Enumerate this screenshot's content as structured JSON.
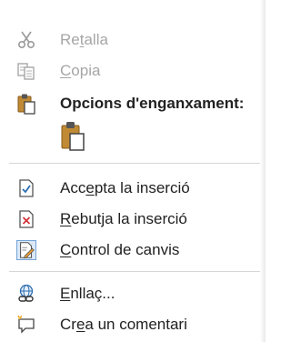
{
  "menu": {
    "cut": {
      "pre": "Re",
      "key": "t",
      "post": "alla",
      "icon": "scissors-icon",
      "enabled": false
    },
    "copy": {
      "pre": "",
      "key": "C",
      "post": "opia",
      "icon": "copy-icon",
      "enabled": false
    },
    "paste_options": {
      "label": "Opcions d'enganxament:",
      "icon": "clipboard-icon",
      "option_icon": "paste-keep-text-icon"
    },
    "accept": {
      "pre": "Acc",
      "key": "e",
      "post": "pta la inserció",
      "icon": "accept-change-icon"
    },
    "reject": {
      "pre": "",
      "key": "R",
      "post": "ebutja la inserció",
      "icon": "reject-change-icon"
    },
    "track": {
      "pre": "",
      "key": "C",
      "post": "ontrol de canvis",
      "icon": "track-changes-icon"
    },
    "link": {
      "pre": "",
      "key": "E",
      "post": "nllaç...",
      "icon": "link-icon"
    },
    "comment": {
      "pre": "Cr",
      "key": "e",
      "post": "a un comentari",
      "icon": "new-comment-icon"
    }
  },
  "colors": {
    "text": "#222222",
    "disabled": "#a6a6a6",
    "clipboard_brown": "#b07a2a",
    "reject_red": "#d13438",
    "accent_blue": "#2b6cb0"
  }
}
